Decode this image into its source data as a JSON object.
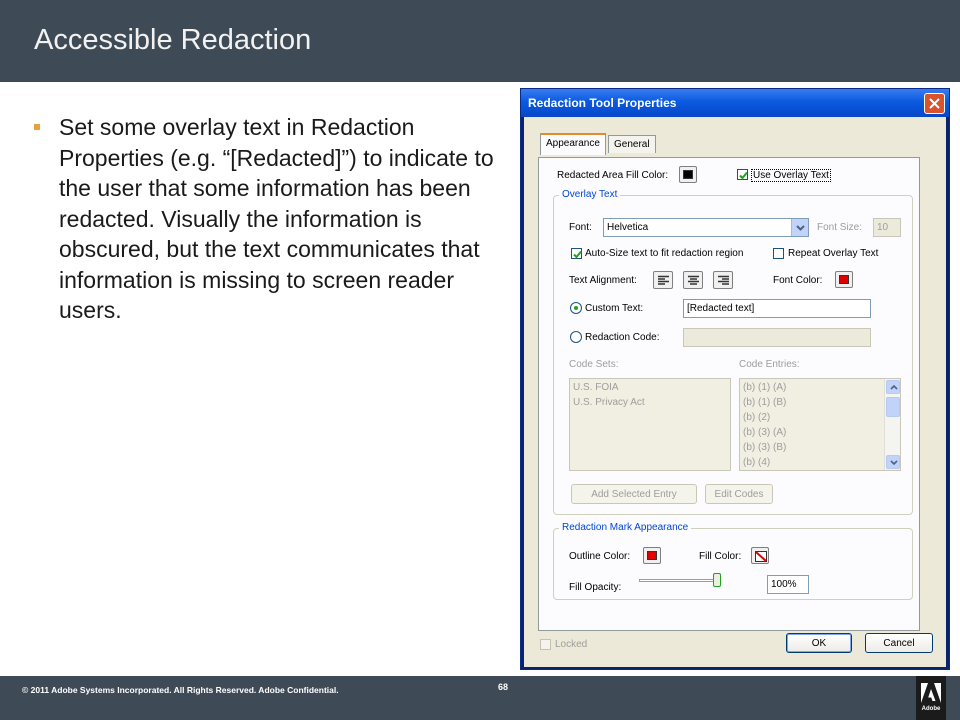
{
  "slide": {
    "title": "Accessible Redaction",
    "bullet": "Set some overlay text in Redaction Properties (e.g. “[Redacted]”) to indicate to the user that some information has been redacted. Visually the information is obscured, but the text communicates that information is missing to screen reader users.",
    "footer": {
      "copyright": "© 2011 Adobe Systems Incorporated.  All Rights Reserved.  Adobe Confidential.",
      "page_number": "68",
      "logo_text": "Adobe"
    }
  },
  "dialog": {
    "title": "Redaction Tool Properties",
    "tabs": [
      {
        "label": "Appearance",
        "active": true
      },
      {
        "label": "General",
        "active": false
      }
    ],
    "fill_color_label": "Redacted Area Fill Color:",
    "fill_color": "#000000",
    "use_overlay_label": "Use Overlay Text",
    "use_overlay_checked": true,
    "overlay_group": {
      "title": "Overlay Text",
      "font_label": "Font:",
      "font_value": "Helvetica",
      "font_size_label": "Font Size:",
      "font_size_value": "10",
      "autosize_label": "Auto-Size text to fit redaction region",
      "autosize_checked": true,
      "repeat_label": "Repeat Overlay Text",
      "repeat_checked": false,
      "alignment_label": "Text Alignment:",
      "alignment_icons": [
        "align-left-icon",
        "align-center-icon",
        "align-right-icon"
      ],
      "font_color_label": "Font Color:",
      "font_color": "#e00000",
      "custom_text_label": "Custom Text:",
      "custom_text_value": "[Redacted text]",
      "custom_text_selected": true,
      "redaction_code_label": "Redaction Code:",
      "code_sets_label": "Code Sets:",
      "code_sets": [
        "U.S. FOIA",
        "U.S. Privacy Act"
      ],
      "code_entries_label": "Code Entries:",
      "code_entries": [
        "(b) (1) (A)",
        "(b) (1) (B)",
        "(b) (2)",
        "(b) (3) (A)",
        "(b) (3) (B)",
        "(b) (4)"
      ],
      "add_entry_label": "Add Selected Entry",
      "edit_codes_label": "Edit Codes"
    },
    "mark_group": {
      "title": "Redaction Mark Appearance",
      "outline_color_label": "Outline Color:",
      "outline_color": "#e00000",
      "fill_color_label": "Fill Color:",
      "fill_opacity_label": "Fill Opacity:",
      "fill_opacity_value": "100%",
      "fill_opacity_level": 1.0
    },
    "locked_label": "Locked",
    "locked_checked": false,
    "ok_label": "OK",
    "cancel_label": "Cancel"
  }
}
